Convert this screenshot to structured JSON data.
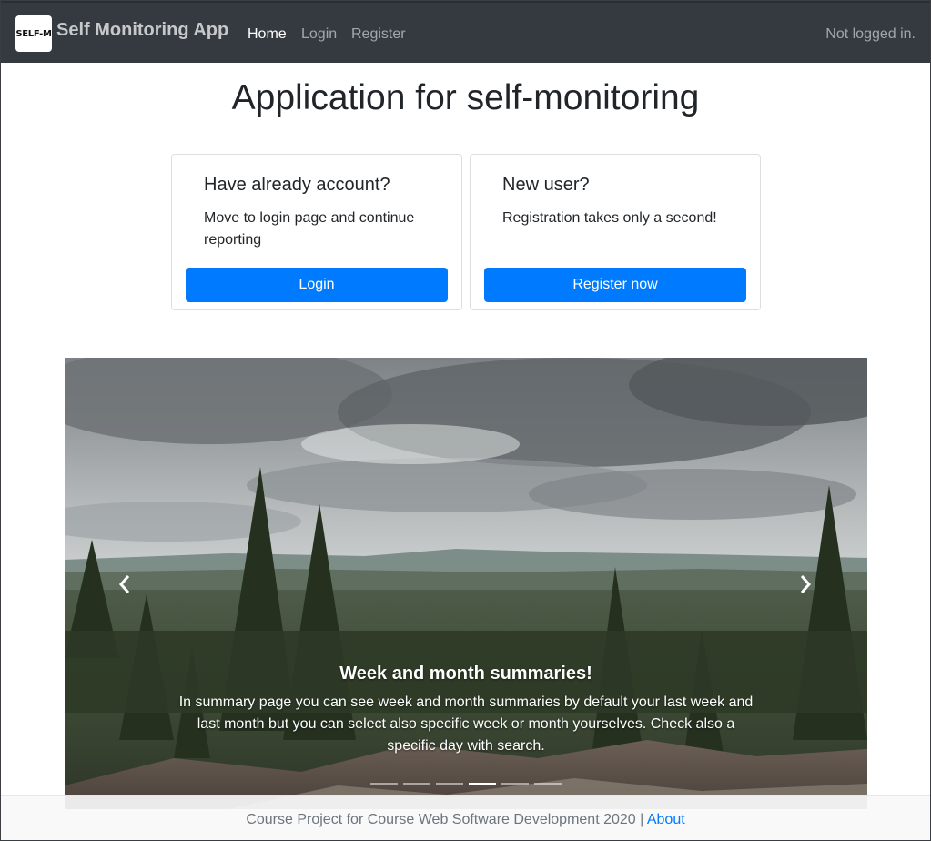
{
  "navbar": {
    "logo_text": "SELF-M",
    "brand": "Self Monitoring App",
    "links": [
      {
        "label": "Home",
        "active": true
      },
      {
        "label": "Login",
        "active": false
      },
      {
        "label": "Register",
        "active": false
      }
    ],
    "status": "Not logged in."
  },
  "page": {
    "title": "Application for self-monitoring"
  },
  "cards": [
    {
      "title": "Have already account?",
      "text": "Move to login page and continue reporting",
      "button": "Login"
    },
    {
      "title": "New user?",
      "text": "Registration takes only a second!",
      "button": "Register now"
    }
  ],
  "carousel": {
    "caption_title": "Week and month summaries!",
    "caption_text": "In summary page you can see week and month summaries by default your last week and last month but you can select also specific week or month yourselves. Check also a specific day with search.",
    "indicator_count": 6,
    "active_index": 3,
    "prev_icon": "chevron-left-icon",
    "next_icon": "chevron-right-icon"
  },
  "footer": {
    "text": "Course Project for Course Web Software Development 2020 |",
    "link": "About"
  },
  "colors": {
    "navbar_bg": "#343a40",
    "primary": "#007bff",
    "footer_link": "#007bff"
  }
}
